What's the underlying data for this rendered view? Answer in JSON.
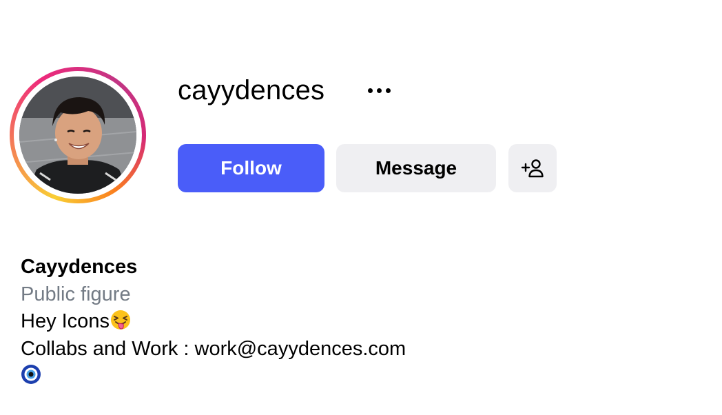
{
  "profile": {
    "username": "cayydences",
    "display_name": "Cayydences",
    "category": "Public figure",
    "bio_line1": "Hey Icons",
    "bio_line1_emoji": "squinting-face-with-tongue-emoji",
    "bio_line2": "Collabs and Work : work@cayydences.com",
    "bio_line3_emoji": "nazar-amulet-emoji",
    "has_story_ring": true
  },
  "actions": {
    "follow_label": "Follow",
    "message_label": "Message",
    "more_icon": "more-horizontal-icon",
    "suggest_icon": "add-person-icon"
  },
  "colors": {
    "follow_button": "#4a5df9",
    "secondary_button": "#efeff2",
    "category_text": "#737b85",
    "story_ring_start": "#f9ce34",
    "story_ring_mid": "#ee2a7b",
    "story_ring_end": "#c13584"
  }
}
